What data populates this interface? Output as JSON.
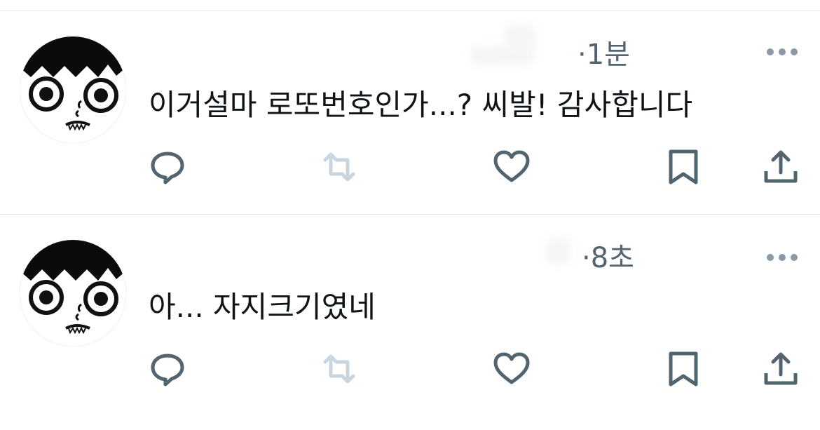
{
  "tweets": [
    {
      "time": "·1분",
      "text": "이거설마 로또번호인가...? 씨발! 감사합니다"
    },
    {
      "time": "·8초",
      "text": "아... 자지크기였네"
    }
  ],
  "icons": {
    "more": "more-icon",
    "reply": "reply-icon",
    "retweet": "retweet-icon",
    "like": "like-icon",
    "bookmark": "bookmark-icon",
    "share": "share-icon"
  },
  "colors": {
    "text": "#0f1419",
    "secondary": "#536471",
    "icon": "#536471",
    "retweet_disabled": "#c9d6df",
    "divider": "#e1e6ea"
  }
}
